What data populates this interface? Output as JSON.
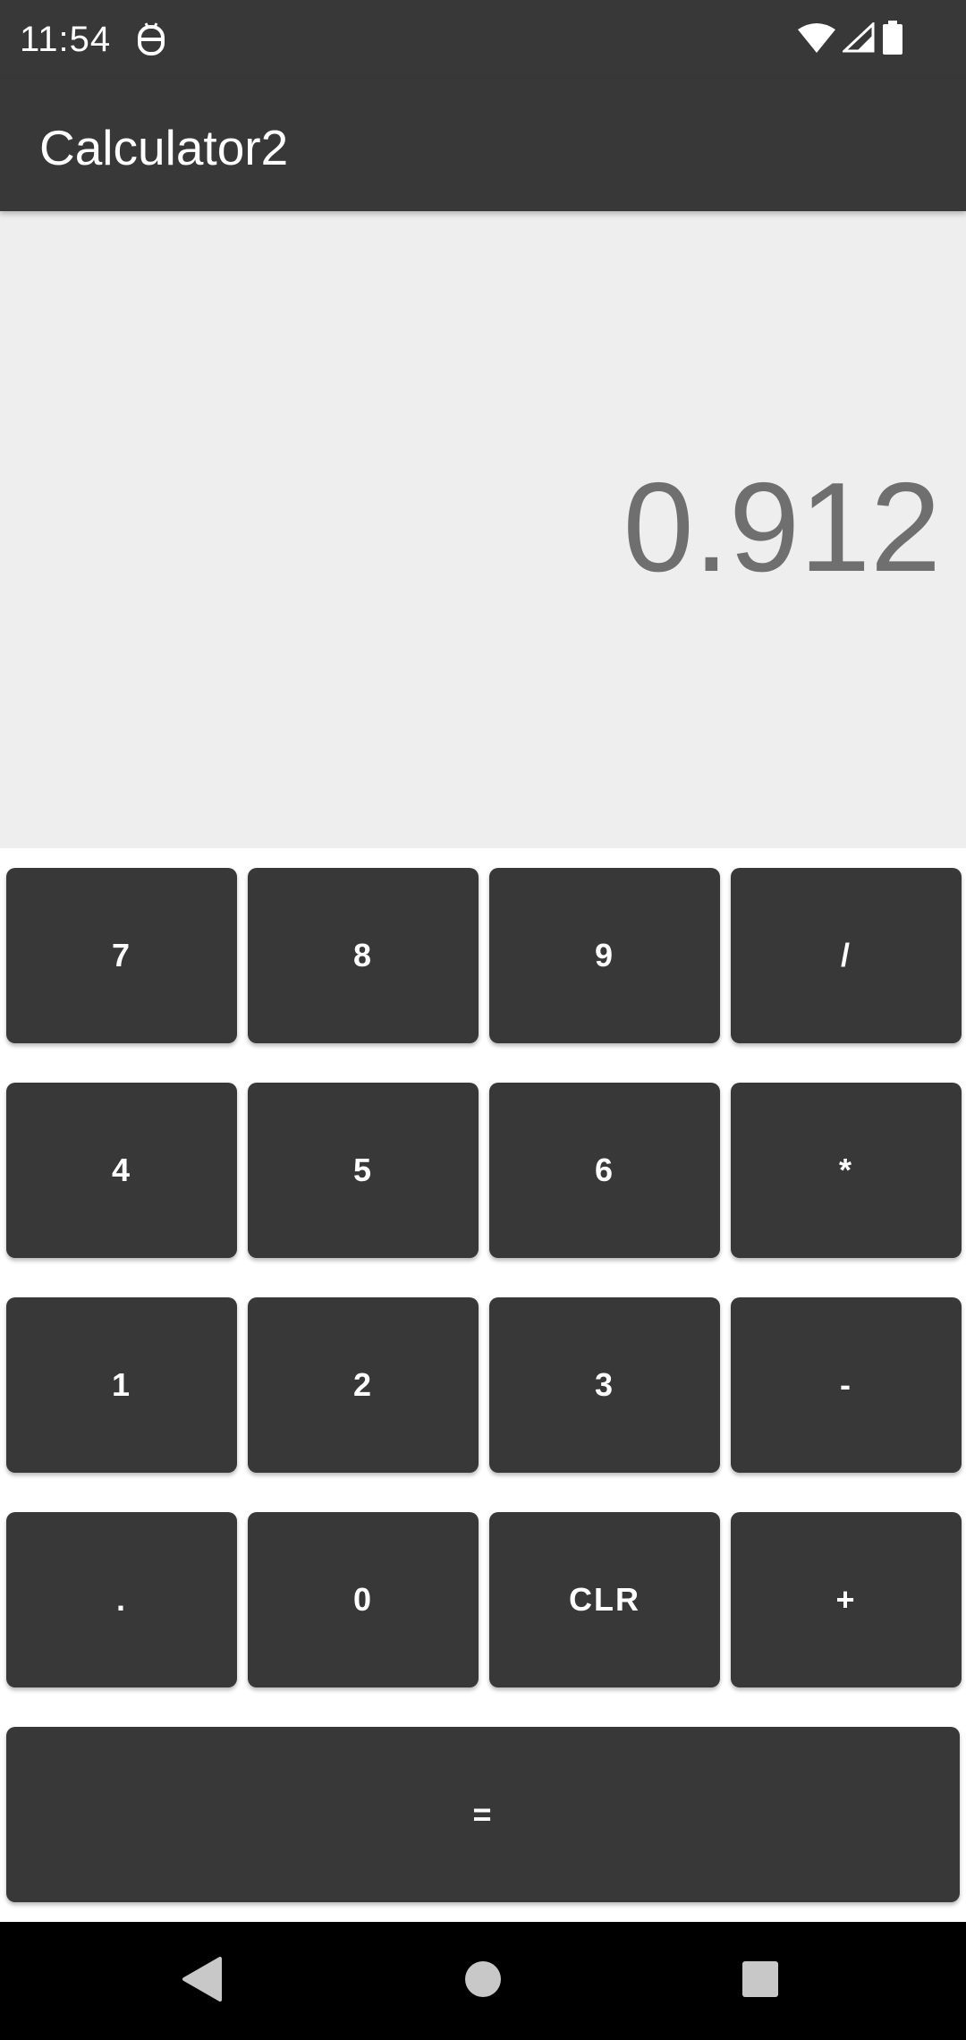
{
  "status_bar": {
    "time": "11:54"
  },
  "app_bar": {
    "title": "Calculator2"
  },
  "display": {
    "value": "0.912"
  },
  "keypad": {
    "rows": [
      [
        "7",
        "8",
        "9",
        "/"
      ],
      [
        "4",
        "5",
        "6",
        "*"
      ],
      [
        "1",
        "2",
        "3",
        "-"
      ],
      [
        ".",
        "0",
        "CLR",
        "+"
      ]
    ],
    "equals": "="
  },
  "colors": {
    "bar": "#383838",
    "display_bg": "#eeeeee",
    "display_text": "#6f6f6f",
    "key_bg": "#383838",
    "key_text": "#ffffff"
  }
}
